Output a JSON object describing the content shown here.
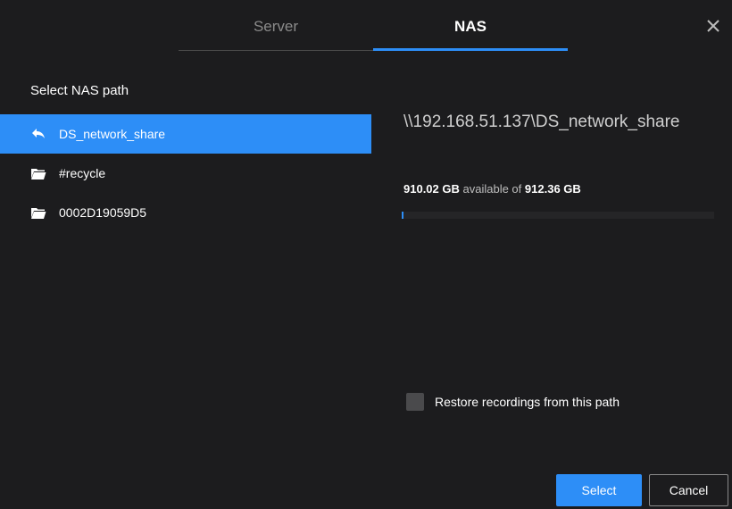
{
  "tabs": {
    "server_label": "Server",
    "nas_label": "NAS",
    "active": "NAS"
  },
  "close_icon": "close-icon",
  "section_title": "Select NAS path",
  "tree": {
    "parent": {
      "label": "DS_network_share",
      "icon": "back-arrow-icon",
      "selected": true
    },
    "children": [
      {
        "label": "#recycle",
        "icon": "folder-open-icon"
      },
      {
        "label": "0002D19059D5",
        "icon": "folder-open-icon"
      }
    ]
  },
  "details": {
    "path": "\\\\192.168.51.137\\DS_network_share",
    "available": "910.02 GB",
    "available_of_text": "available of",
    "total": "912.36 GB",
    "used_fraction": 0.0026
  },
  "restore": {
    "label": "Restore recordings from this path",
    "checked": false
  },
  "buttons": {
    "select_label": "Select",
    "cancel_label": "Cancel"
  },
  "colors": {
    "background": "#1c1c1e",
    "accent": "#2d8ef7",
    "muted_text": "#8a8a8a"
  }
}
